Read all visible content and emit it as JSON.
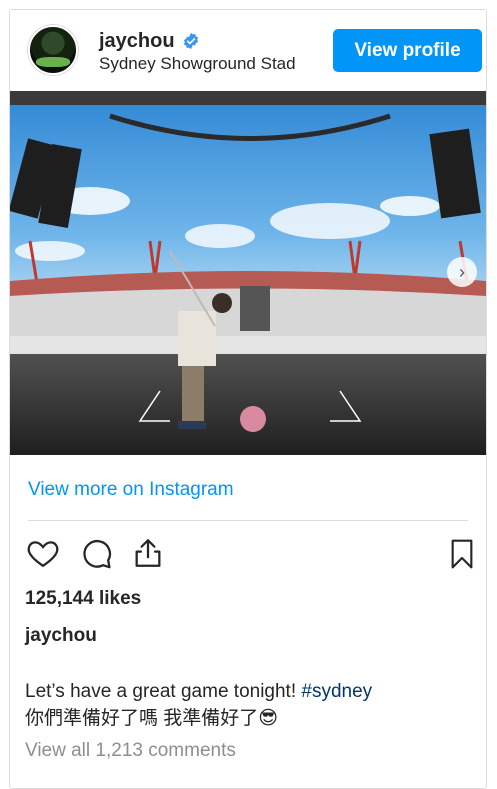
{
  "header": {
    "username": "jaychou",
    "location": "Sydney Showground Stad",
    "view_profile_label": "View profile"
  },
  "post": {
    "image_icon": "carousel-next-icon",
    "view_more_label": "View more on Instagram",
    "likes": "125,144 likes",
    "caption_user": "jaychou",
    "caption_text": "Let’s have a great game tonight!",
    "caption_hashtag": "#sydney",
    "caption_line2": "你們準備好了嗎 我準備好了",
    "caption_emoji": "😎",
    "comments_label": "View all 1,213 comments"
  },
  "colors": {
    "accent": "#0095f6",
    "text": "#262626",
    "muted": "#8e8e8e",
    "hashtag": "#00376b"
  }
}
